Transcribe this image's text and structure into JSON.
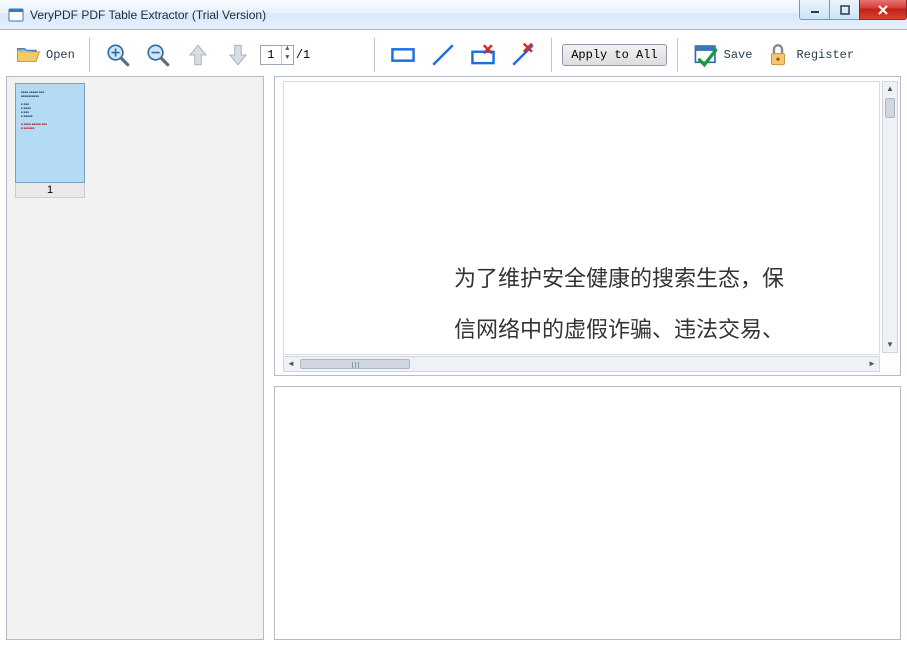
{
  "window": {
    "title": "VeryPDF PDF Table Extractor (Trial Version)"
  },
  "toolbar": {
    "open_label": "Open",
    "page_current": "1",
    "page_total": "/1",
    "apply_label": "Apply to All",
    "save_label": "Save",
    "register_label": "Register"
  },
  "thumbnails": {
    "items": [
      {
        "page_label": "1"
      }
    ]
  },
  "preview": {
    "line1": "为了维护安全健康的搜索生态，保",
    "line2": "信网络中的虚假诈骗、违法交易、"
  },
  "icons": {
    "open": "folder-open-icon",
    "zoom_in": "zoom-in-icon",
    "zoom_out": "zoom-out-icon",
    "page_prev": "page-up-icon",
    "page_next": "page-down-icon",
    "draw_rect": "rectangle-icon",
    "draw_line": "line-icon",
    "del_rect": "delete-rectangle-icon",
    "del_line": "delete-line-icon",
    "save": "calendar-check-icon",
    "register": "padlock-icon"
  }
}
